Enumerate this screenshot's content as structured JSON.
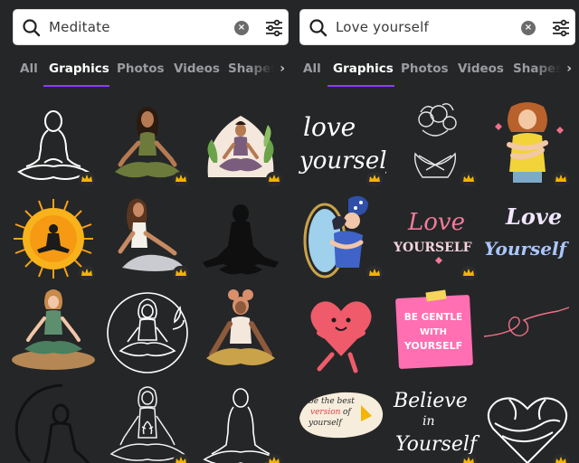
{
  "colors": {
    "background": "#252627",
    "active_tab": "#ffffff",
    "inactive_tab": "#9b9ca0",
    "accent_underline": "#8b3dff",
    "premium_crown": "#f4b400"
  },
  "panels": [
    {
      "search": {
        "value": "Meditate",
        "icons": [
          "search-icon",
          "clear-icon",
          "filter-icon"
        ]
      },
      "tabs": [
        "All",
        "Graphics",
        "Photos",
        "Videos",
        "Shapes"
      ],
      "active_tab": "Graphics",
      "results": [
        {
          "name": "outline-meditating-figure",
          "premium": true
        },
        {
          "name": "woman-in-lotus-pose",
          "premium": true
        },
        {
          "name": "woman-meditating-with-plants",
          "premium": true
        },
        {
          "name": "meditation-sun-burst",
          "premium": true
        },
        {
          "name": "woman-stretching-on-mat",
          "premium": true
        },
        {
          "name": "black-silhouette-meditation",
          "premium": false
        },
        {
          "name": "woman-on-yoga-mat",
          "premium": false
        },
        {
          "name": "line-art-meditation-circle",
          "premium": false
        },
        {
          "name": "woman-with-hair-buns-meditating",
          "premium": false
        },
        {
          "name": "circle-outline-silhouette",
          "premium": false
        },
        {
          "name": "floral-line-meditation",
          "premium": true
        },
        {
          "name": "white-outline-meditation",
          "premium": true
        }
      ]
    },
    {
      "search": {
        "value": "Love yourself",
        "icons": [
          "search-icon",
          "clear-icon",
          "filter-icon"
        ]
      },
      "tabs": [
        "All",
        "Graphics",
        "Photos",
        "Videos",
        "Shapes"
      ],
      "active_tab": "Graphics",
      "results": [
        {
          "name": "love-yourself-lettering",
          "text_lines": [
            "love",
            "yourself"
          ],
          "premium": true
        },
        {
          "name": "floral-head-self-hug",
          "premium": true
        },
        {
          "name": "woman-hugging-herself",
          "premium": true
        },
        {
          "name": "mirror-self-hug",
          "premium": true
        },
        {
          "name": "love-yourself-pink-script",
          "text_lines": [
            "Love",
            "YOURSELF"
          ],
          "premium": true
        },
        {
          "name": "love-yourself-pastel-script",
          "text_lines": [
            "Love",
            "Yourself"
          ],
          "premium": false
        },
        {
          "name": "hugging-heart-character",
          "premium": false
        },
        {
          "name": "be-gentle-note",
          "text_lines": [
            "BE GENTLE",
            "WITH",
            "YOURSELF"
          ],
          "premium": false
        },
        {
          "name": "heart-doodle-line",
          "premium": false
        },
        {
          "name": "best-version-badge",
          "text_lines": [
            "be the best",
            "version",
            "of",
            "yourself"
          ],
          "premium": false
        },
        {
          "name": "believe-in-yourself-lettering",
          "text_lines": [
            "Believe",
            "in",
            "Yourself"
          ],
          "premium": true
        },
        {
          "name": "heart-hands-hug",
          "premium": true
        }
      ]
    }
  ]
}
